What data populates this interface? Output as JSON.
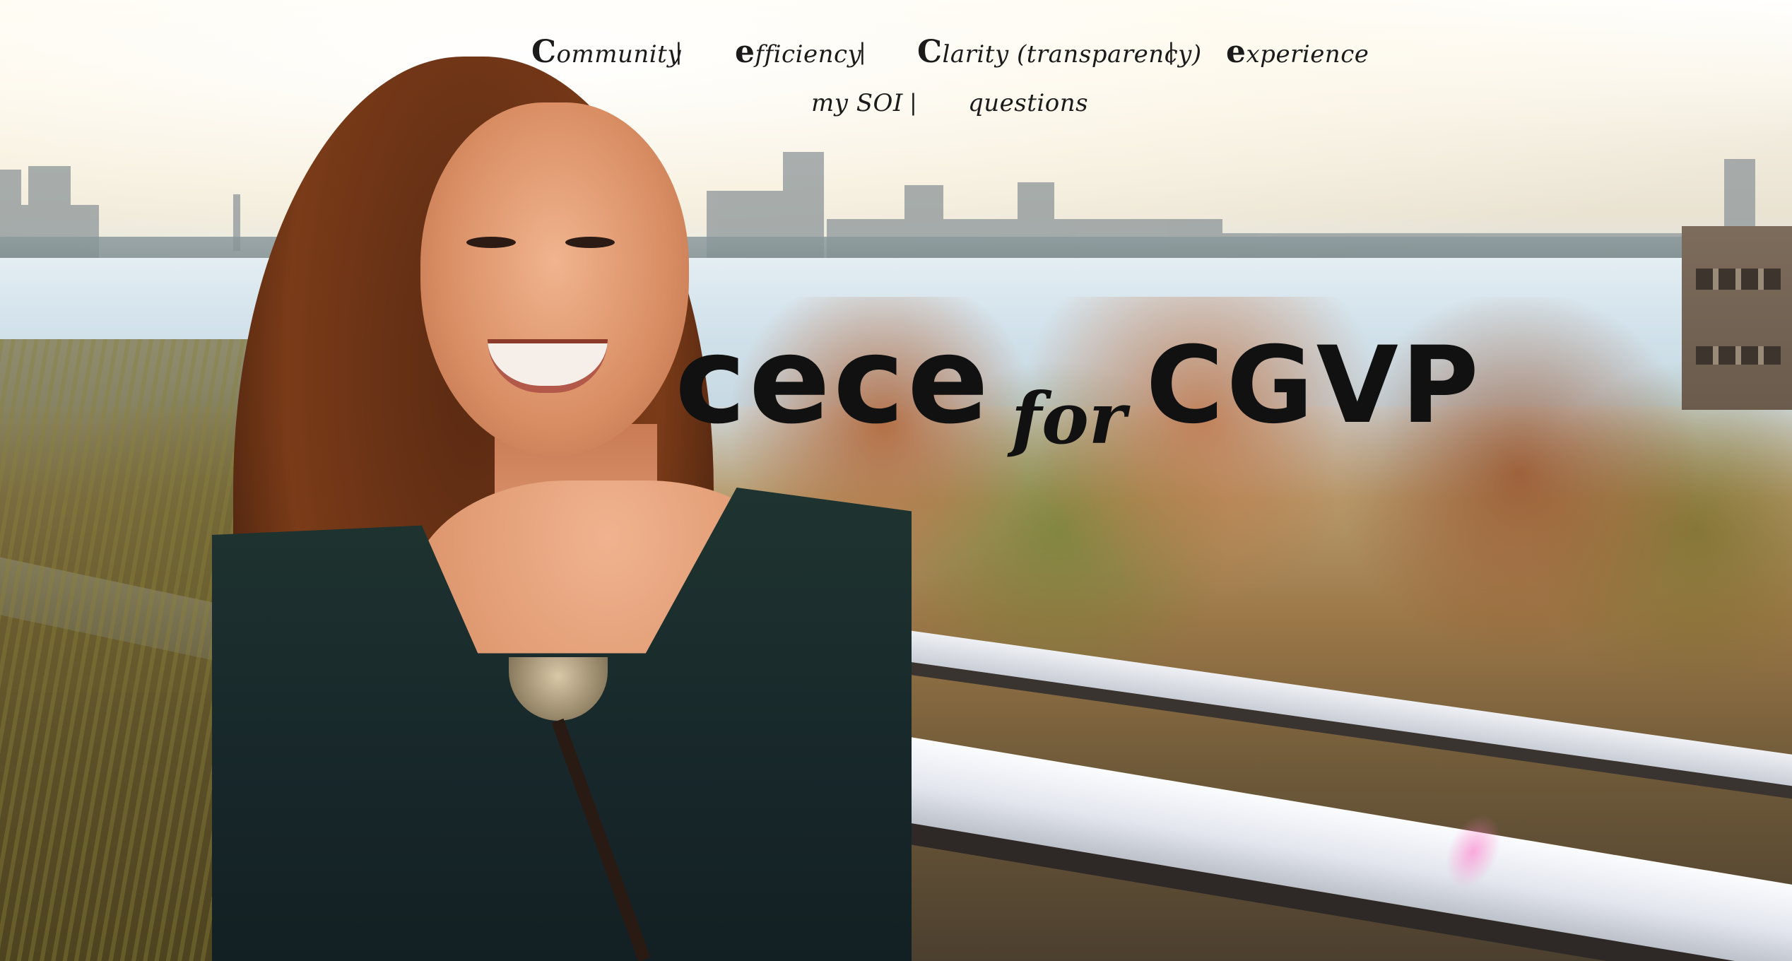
{
  "nav": {
    "row1": [
      {
        "cap": "C",
        "rest": "ommunity"
      },
      {
        "cap": "e",
        "rest": "fficiency"
      },
      {
        "cap": "C",
        "rest": "larity (transparency)"
      },
      {
        "cap": "e",
        "rest": "xperience"
      }
    ],
    "row2": [
      {
        "label": "my SOI"
      },
      {
        "label": "questions"
      }
    ],
    "separator": "|"
  },
  "hero": {
    "title_main": "cece",
    "title_for": "for",
    "title_org": "CGVP"
  },
  "colors": {
    "text": "#111111",
    "background": "#ffffff"
  }
}
